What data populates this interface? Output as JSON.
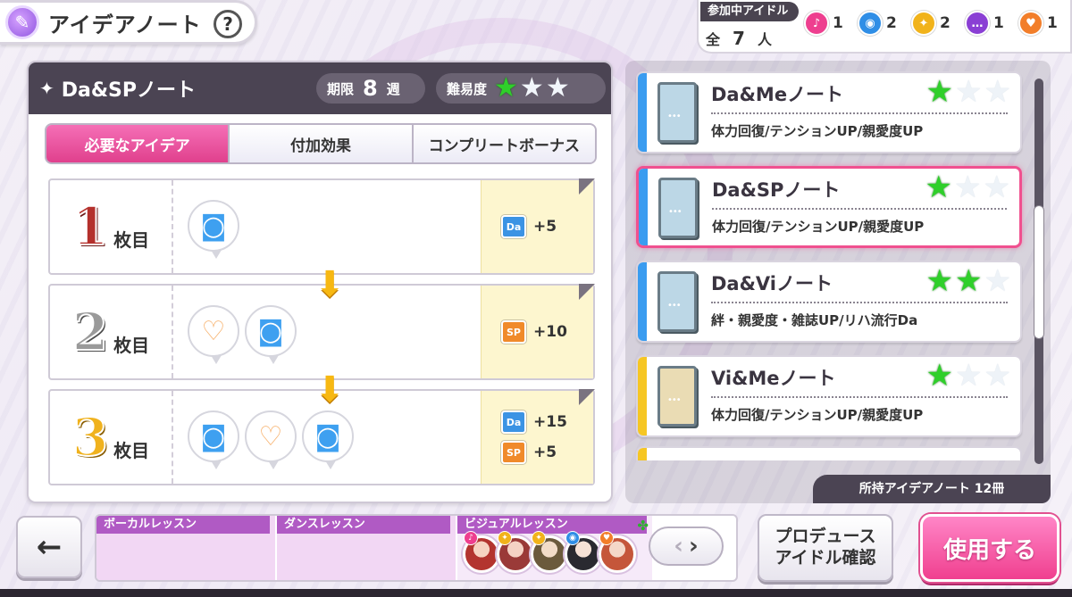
{
  "title": {
    "label": "アイデアノート",
    "help": "?"
  },
  "idols": {
    "label": "参加中アイドル",
    "total_prefix": "全",
    "total_value": "7",
    "total_suffix": "人",
    "types": [
      {
        "icon": "microphone-icon",
        "color": "#ee3f8f",
        "glyph": "♪",
        "count": "1"
      },
      {
        "icon": "speaker-icon",
        "color": "#2f8ee6",
        "glyph": "◉",
        "count": "2"
      },
      {
        "icon": "lightbulb-icon",
        "color": "#f1b31b",
        "glyph": "✦",
        "count": "2"
      },
      {
        "icon": "chat-bubble-icon",
        "color": "#8a3fd4",
        "glyph": "…",
        "count": "1"
      },
      {
        "icon": "heart-icon",
        "color": "#f27e2a",
        "glyph": "♥",
        "count": "1"
      }
    ]
  },
  "note": {
    "name": "Da&SPノート",
    "deadline_label": "期限",
    "deadline_value": "8",
    "deadline_unit": "週",
    "difficulty_label": "難易度",
    "difficulty": 1,
    "difficulty_max": 3
  },
  "tabs": [
    {
      "label": "必要なアイデア",
      "active": true
    },
    {
      "label": "付加効果",
      "active": false
    },
    {
      "label": "コンプリートボーナス",
      "active": false
    }
  ],
  "sheets": [
    {
      "num": "1",
      "unit": "枚目",
      "ideas": [
        "speaker"
      ],
      "bonuses": [
        {
          "type": "Da",
          "value": "+5"
        }
      ]
    },
    {
      "num": "2",
      "unit": "枚目",
      "ideas": [
        "heart",
        "speaker"
      ],
      "bonuses": [
        {
          "type": "SP",
          "value": "+10"
        }
      ]
    },
    {
      "num": "3",
      "unit": "枚目",
      "ideas": [
        "speaker",
        "heart",
        "speaker"
      ],
      "bonuses": [
        {
          "type": "Da",
          "value": "+15"
        },
        {
          "type": "SP",
          "value": "+5"
        }
      ]
    }
  ],
  "note_list": [
    {
      "name": "Da&Meノート",
      "effect": "体力回復/テンションUP/親愛度UP",
      "stars": 1,
      "strip": "blue",
      "book": "blue",
      "selected": false
    },
    {
      "name": "Da&SPノート",
      "effect": "体力回復/テンションUP/親愛度UP",
      "stars": 1,
      "strip": "blue",
      "book": "blue",
      "selected": true
    },
    {
      "name": "Da&Viノート",
      "effect": "絆・親愛度・雑誌UP/リハ流行Da",
      "stars": 2,
      "strip": "blue",
      "book": "blue",
      "selected": false
    },
    {
      "name": "Vi&Meノート",
      "effect": "体力回復/テンションUP/親愛度UP",
      "stars": 1,
      "strip": "yellow",
      "book": "tan",
      "selected": false
    }
  ],
  "owned_label": "所持アイデアノート 12冊",
  "lessons": [
    {
      "label": "ボーカルレッスン"
    },
    {
      "label": "ダンスレッスン"
    },
    {
      "label": "ビジュアルレッスン"
    }
  ],
  "buttons": {
    "back": "←",
    "pager_prev": "‹",
    "pager_next": "›",
    "produce_line1": "プロデュース",
    "produce_line2": "アイドル確認",
    "use": "使用する"
  }
}
